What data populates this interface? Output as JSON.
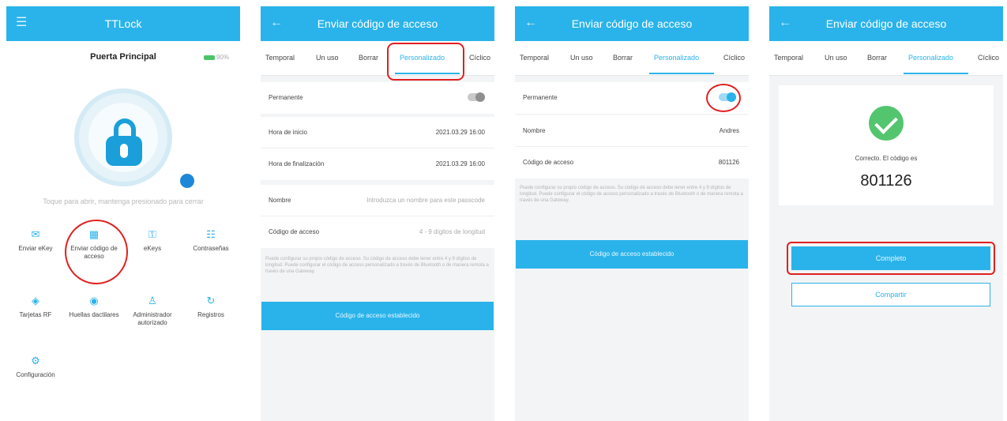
{
  "screen1": {
    "title": "TTLock",
    "lock_name": "Puerta Principal",
    "battery": "90%",
    "hint": "Toque para abrir, mantenga presionado para cerrar",
    "grid": [
      {
        "label": "Enviar eKey",
        "icon": "send-ekey-icon"
      },
      {
        "label": "Enviar código de acceso",
        "icon": "passcode-icon"
      },
      {
        "label": "eKeys",
        "icon": "ekeys-icon"
      },
      {
        "label": "Contraseñas",
        "icon": "passwords-icon"
      },
      {
        "label": "Tarjetas RF",
        "icon": "rf-card-icon"
      },
      {
        "label": "Huellas dactilares",
        "icon": "fingerprint-icon"
      },
      {
        "label": "Administrador autorizado",
        "icon": "admin-icon"
      },
      {
        "label": "Registros",
        "icon": "records-icon"
      },
      {
        "label": "Configuración",
        "icon": "settings-icon"
      }
    ]
  },
  "send_title": "Enviar código de acceso",
  "tabs": [
    "Temporal",
    "Un uso",
    "Borrar",
    "Personalizado",
    "Cíclico"
  ],
  "screen2": {
    "permanent_label": "Permanente",
    "start_label": "Hora de inicio",
    "start_value": "2021.03.29 16:00",
    "end_label": "Hora de finalización",
    "end_value": "2021.03.29 16:00",
    "name_label": "Nombre",
    "name_placeholder": "Introduzca un nombre para este passcode",
    "code_label": "Código de acceso",
    "code_placeholder": "4 - 9 dígitos de longitud",
    "note": "Puede configurar su propio código de acceso. Su código de acceso debe tener entre 4 y 9 dígitos de longitud. Puede configurar el código de acceso personalizado a través de Bluetooth o de manera remota a través de una Gateway.",
    "button": "Código de acceso establecido"
  },
  "screen3": {
    "permanent_label": "Permanente",
    "name_label": "Nombre",
    "name_value": "Andres",
    "code_label": "Código de acceso",
    "code_value": "801126",
    "note": "Puede configurar su propio código de acceso. Su código de acceso debe tener entre 4 y 9 dígitos de longitud. Puede configurar el código de acceso personalizado a través de Bluetooth o de manera remota a través de una Gateway.",
    "button": "Código de acceso establecido"
  },
  "screen4": {
    "success_text": "Correcto. El código es",
    "code": "801126",
    "complete_button": "Completo",
    "share_button": "Compartir"
  },
  "colors": {
    "accent": "#2ab3ea",
    "highlight": "#e02020",
    "success": "#53c56e"
  }
}
